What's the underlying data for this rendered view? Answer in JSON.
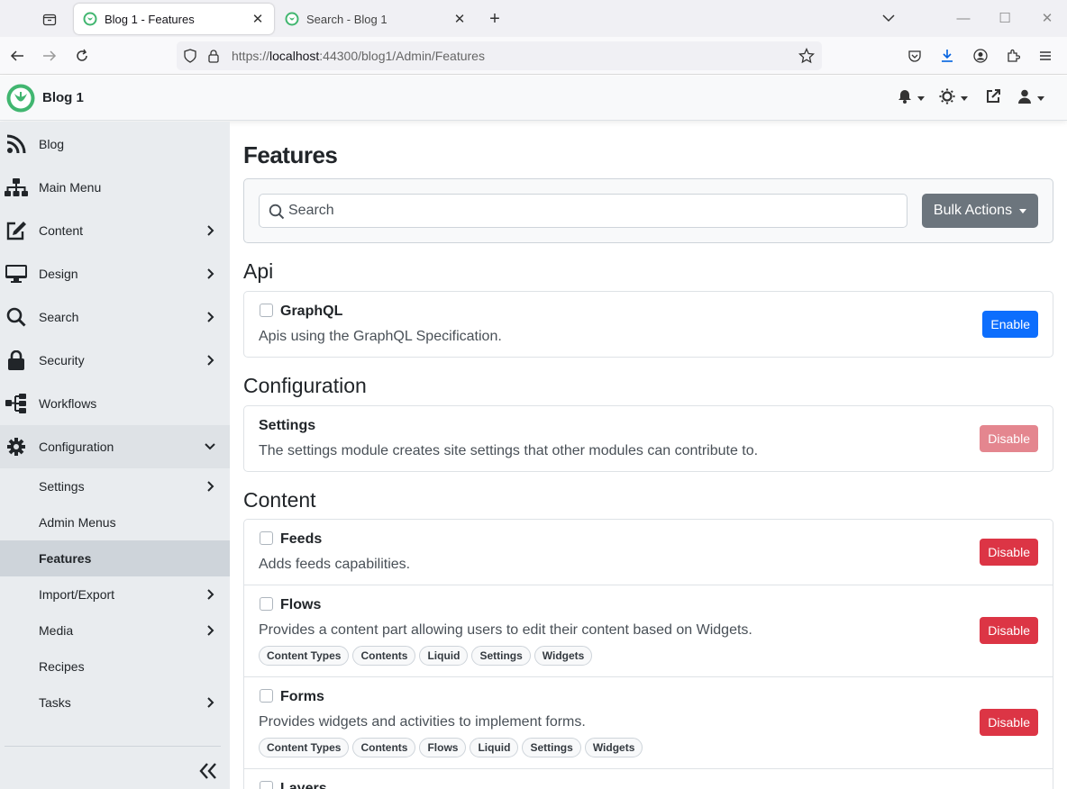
{
  "browser": {
    "tabs": [
      {
        "title": "Blog 1 - Features",
        "active": true
      },
      {
        "title": "Search - Blog 1",
        "active": false
      }
    ],
    "url_prefix": "https://",
    "url_host": "localhost",
    "url_rest": ":44300/blog1/Admin/Features"
  },
  "app": {
    "brand": "Blog 1"
  },
  "sidebar": {
    "items": [
      {
        "label": "Blog",
        "icon": "rss-icon"
      },
      {
        "label": "Main Menu",
        "icon": "sitemap-icon"
      },
      {
        "label": "Content",
        "icon": "edit-icon"
      },
      {
        "label": "Design",
        "icon": "desktop-icon"
      },
      {
        "label": "Search",
        "icon": "search-icon"
      },
      {
        "label": "Security",
        "icon": "lock-icon"
      },
      {
        "label": "Workflows",
        "icon": "workflow-icon"
      },
      {
        "label": "Configuration",
        "icon": "cog-icon"
      }
    ],
    "sub_items": [
      {
        "label": "Settings"
      },
      {
        "label": "Admin Menus"
      },
      {
        "label": "Features"
      },
      {
        "label": "Import/Export"
      },
      {
        "label": "Media"
      },
      {
        "label": "Recipes"
      },
      {
        "label": "Tasks"
      }
    ]
  },
  "main": {
    "title": "Features",
    "search_placeholder": "Search",
    "bulk_actions": "Bulk Actions",
    "categories": [
      {
        "name": "Api",
        "features": [
          {
            "name": "GraphQL",
            "description": "Apis using the GraphQL Specification.",
            "action": "Enable",
            "tags": []
          }
        ]
      },
      {
        "name": "Configuration",
        "features": [
          {
            "name": "Settings",
            "description": "The settings module creates site settings that other modules can contribute to.",
            "action": "Disable",
            "tags": []
          }
        ]
      },
      {
        "name": "Content",
        "features": [
          {
            "name": "Feeds",
            "description": "Adds feeds capabilities.",
            "action": "Disable",
            "tags": []
          },
          {
            "name": "Flows",
            "description": "Provides a content part allowing users to edit their content based on Widgets.",
            "action": "Disable",
            "tags": [
              "Content Types",
              "Contents",
              "Liquid",
              "Settings",
              "Widgets"
            ]
          },
          {
            "name": "Forms",
            "description": "Provides widgets and activities to implement forms.",
            "action": "Disable",
            "tags": [
              "Content Types",
              "Contents",
              "Flows",
              "Liquid",
              "Settings",
              "Widgets"
            ]
          },
          {
            "name": "Layers",
            "description": "",
            "action": "",
            "tags": []
          }
        ]
      }
    ]
  },
  "colors": {
    "primary": "#0d6efd",
    "danger": "#dc3545",
    "secondary": "#6c757d",
    "brand_green": "#41b670"
  }
}
